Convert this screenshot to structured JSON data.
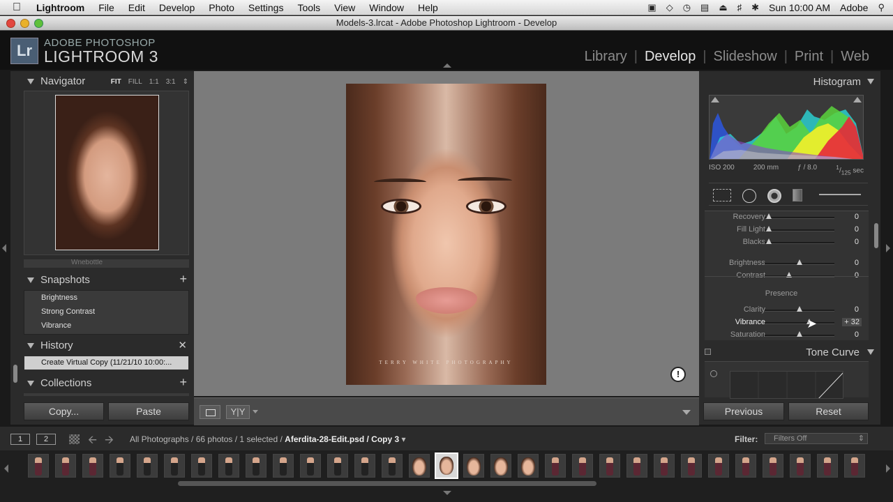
{
  "menubar": {
    "apple": "",
    "app": "Lightroom",
    "items": [
      "File",
      "Edit",
      "Develop",
      "Photo",
      "Settings",
      "Tools",
      "View",
      "Window",
      "Help"
    ],
    "clock": "Sun 10:00 AM",
    "user": "Adobe"
  },
  "window": {
    "title": "Models-3.lrcat - Adobe Photoshop Lightroom - Develop"
  },
  "identity": {
    "logo": "Lr",
    "line1": "ADOBE PHOTOSHOP",
    "line2": "LIGHTROOM 3",
    "modules": [
      "Library",
      "Develop",
      "Slideshow",
      "Print",
      "Web"
    ],
    "active_module": "Develop"
  },
  "left": {
    "navigator": {
      "title": "Navigator",
      "zoom": [
        "FIT",
        "FILL",
        "1:1",
        "3:1"
      ]
    },
    "partial_item": "Wnebottle",
    "snapshots": {
      "title": "Snapshots",
      "items": [
        "Brightness",
        "Strong Contrast",
        "Vibrance"
      ]
    },
    "history": {
      "title": "History",
      "item": "Create Virtual Copy (11/21/10 10:00:..."
    },
    "collections": {
      "title": "Collections"
    },
    "copy_label": "Copy...",
    "paste_label": "Paste"
  },
  "photo": {
    "watermark": "TERRY WHITE PHOTOGRAPHY"
  },
  "right": {
    "histogram": {
      "title": "Histogram",
      "iso": "ISO 200",
      "focal": "200 mm",
      "aperture": "ƒ / 8.0",
      "shutter_num": "1",
      "shutter_den": "125",
      "shutter_unit": "sec"
    },
    "sliders": [
      {
        "name": "Recovery",
        "value": "0",
        "pos": 0.06
      },
      {
        "name": "Fill Light",
        "value": "0",
        "pos": 0.06
      },
      {
        "name": "Blacks",
        "value": "0",
        "pos": 0.06
      },
      {
        "name": "Brightness",
        "value": "0",
        "pos": 0.5
      },
      {
        "name": "Contrast",
        "value": "0",
        "pos": 0.35
      },
      {
        "name": "Clarity",
        "value": "0",
        "pos": 0.5
      },
      {
        "name": "Vibrance",
        "value": "+ 32",
        "pos": 0.64
      },
      {
        "name": "Saturation",
        "value": "0",
        "pos": 0.5
      }
    ],
    "presence": "Presence",
    "tone_curve": "Tone Curve",
    "previous_label": "Previous",
    "reset_label": "Reset"
  },
  "filmbar": {
    "screen1": "1",
    "screen2": "2",
    "breadcrumb": "All Photographs / 66 photos / 1 selected /",
    "filename": "Aferdita-28-Edit.psd / Copy 3",
    "filter_label": "Filter:",
    "filter_value": "Filters Off"
  },
  "colors": {
    "accent": "#e6e6e6",
    "panel": "#2b2b2b",
    "background": "#7b7b7b"
  }
}
